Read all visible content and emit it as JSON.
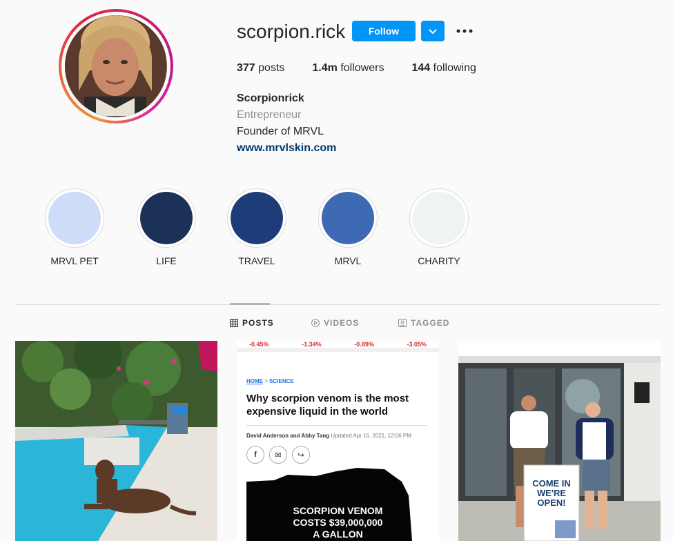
{
  "profile": {
    "username": "scorpion.rick",
    "follow_label": "Follow",
    "stats": {
      "posts_count": "377",
      "posts_label": "posts",
      "followers_count": "1.4m",
      "followers_label": "followers",
      "following_count": "144",
      "following_label": "following"
    },
    "bio": {
      "name": "Scorpionrick",
      "category": "Entrepreneur",
      "line": "Founder of MRVL",
      "link": "www.mrvlskin.com"
    }
  },
  "highlights": [
    {
      "label": "MRVL PET",
      "color": "#cddcf7"
    },
    {
      "label": "LIFE",
      "color": "#1c3157"
    },
    {
      "label": "TRAVEL",
      "color": "#1e3d78"
    },
    {
      "label": "MRVL",
      "color": "#3e6ab3"
    },
    {
      "label": "CHARITY",
      "color": "#eef3f4"
    }
  ],
  "tabs": [
    {
      "label": "POSTS",
      "icon": "grid-icon",
      "active": true
    },
    {
      "label": "VIDEOS",
      "icon": "play-icon",
      "active": false
    },
    {
      "label": "TAGGED",
      "icon": "tag-icon",
      "active": false
    }
  ],
  "posts": {
    "article": {
      "tickers": [
        "-0.45%",
        "-1.34%",
        "-0.89%",
        "-3.05%"
      ],
      "breadcrumb_home": "HOME",
      "breadcrumb_sep": ">",
      "breadcrumb_section": "SCIENCE",
      "headline": "Why scorpion venom is the most expensive liquid in the world",
      "authors": "David Anderson and Abby Tang",
      "updated": "Updated Apr 16, 2021, 12:06 PM",
      "image_caption_1": "SCORPION VENOM",
      "image_caption_2": "COSTS $39,000,000",
      "image_caption_3": "A GALLON"
    },
    "store": {
      "sign_line1": "COME IN",
      "sign_line2": "WE'RE",
      "sign_line3": "OPEN!"
    }
  },
  "colors": {
    "accent": "#0095f6",
    "link": "#00376b",
    "muted": "#8e8e8e"
  }
}
